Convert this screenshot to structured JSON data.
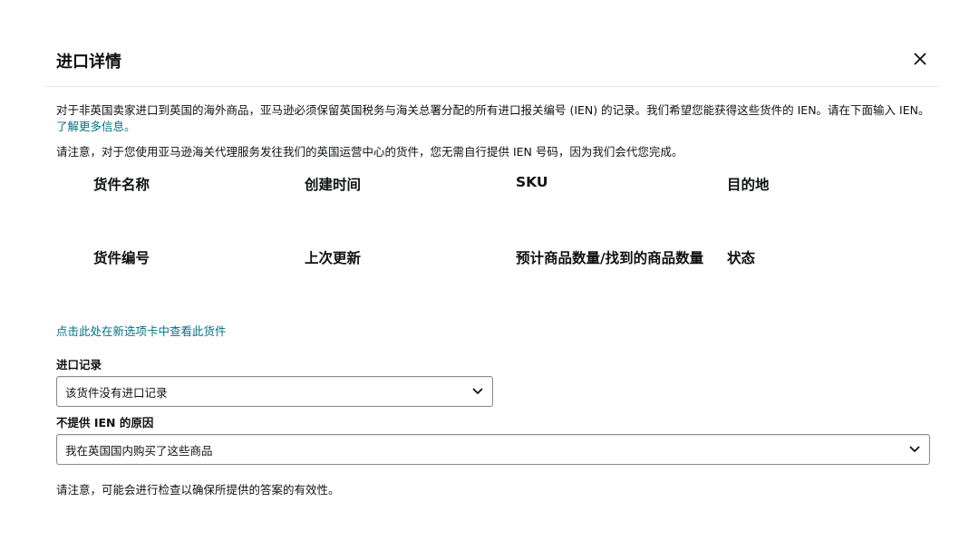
{
  "modal": {
    "title": "进口详情",
    "close_icon": "close-icon"
  },
  "intro": {
    "text": "对于非英国卖家进口到英国的海外商品，亚马逊必须保留英国税务与海关总署分配的所有进口报关编号 (IEN) 的记录。我们希望您能获得这些货件的 IEN。请在下面输入 IEN。",
    "learn_more": "了解更多信息。"
  },
  "note_customs": "请注意，对于您使用亚马逊海关代理服务发往我们的英国运营中心的货件，您无需自行提供 IEN 号码，因为我们会代您完成。",
  "shipment_fields": {
    "row1": [
      "货件名称",
      "创建时间",
      "SKU",
      "目的地"
    ],
    "row2": [
      "货件编号",
      "上次更新",
      "预计商品数量/找到的商品数量",
      "状态"
    ]
  },
  "view_shipment_link": "点击此处在新选项卡中查看此货件",
  "import_record": {
    "label": "进口记录",
    "selected": "该货件没有进口记录"
  },
  "no_ien_reason": {
    "label": "不提供 IEN 的原因",
    "selected": "我在英国国内购买了这些商品"
  },
  "note_validation": "请注意，可能会进行检查以确保所提供的答案的有效性。"
}
